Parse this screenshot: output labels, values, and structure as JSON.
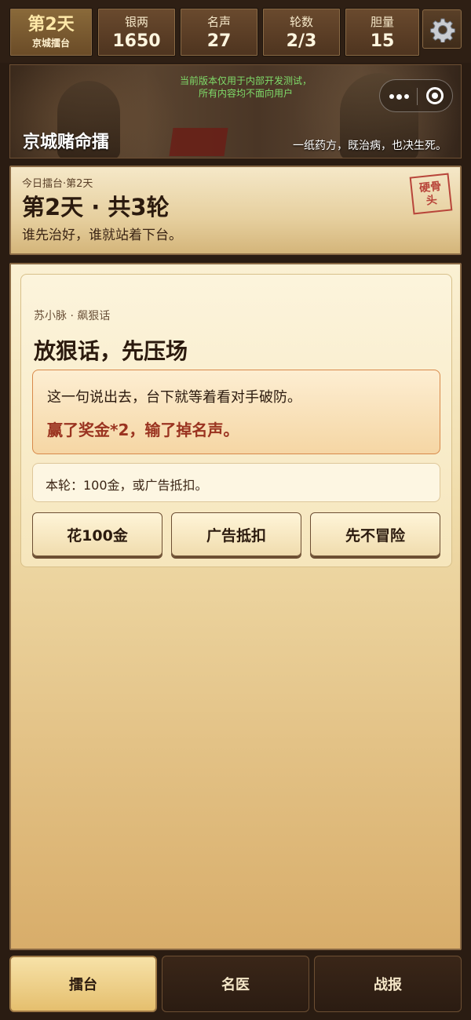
{
  "topbar": {
    "day": {
      "title": "第2天",
      "subtitle": "京城擂台"
    },
    "stats": [
      {
        "label": "银两",
        "value": "1650"
      },
      {
        "label": "名声",
        "value": "27"
      },
      {
        "label": "轮数",
        "value": "2/3"
      },
      {
        "label": "胆量",
        "value": "15"
      }
    ],
    "settings_icon": "gear-icon"
  },
  "banner": {
    "dev_note_line1": "当前版本仅用于内部开发测试，",
    "dev_note_line2": "所有内容均不面向用户",
    "title": "京城赌命擂",
    "subtitle": "一纸药方，既治病，也决生死。",
    "capsule_icons": [
      "more-icon",
      "close-target-icon"
    ]
  },
  "day_card": {
    "small": "今日擂台·第2天",
    "title": "第2天 · 共3轮",
    "subtitle": "谁先治好，谁就站着下台。",
    "stamp_line1": "硬骨",
    "stamp_line2": "头"
  },
  "event": {
    "tag": "苏小脉 · 飙狠话",
    "title": "放狠话，先压场",
    "desc": "这一句说出去，台下就等着看对手破防。",
    "stakes": "赢了奖金*2，输了掉名声。",
    "cost": "本轮：100金，或广告抵扣。",
    "choices": [
      "花100金",
      "广告抵扣",
      "先不冒险"
    ]
  },
  "nav": {
    "items": [
      "擂台",
      "名医",
      "战报"
    ],
    "active": "擂台"
  },
  "colors": {
    "accent_red": "#9a3320",
    "stamp_red": "#b8453a",
    "dev_note_green": "#7fdc6a",
    "frame_brown": "#8a6a45"
  }
}
